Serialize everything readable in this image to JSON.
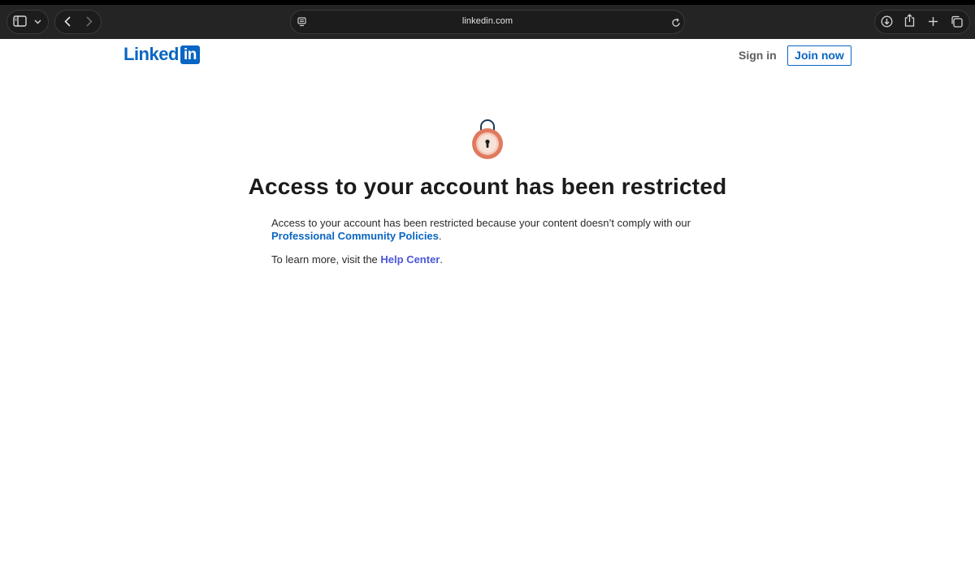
{
  "browser": {
    "url": "linkedin.com",
    "icons": [
      "sidebar-icon",
      "chevron-down-icon",
      "back-icon",
      "forward-icon",
      "page-menu-icon",
      "reload-icon",
      "download-icon",
      "share-icon",
      "new-tab-icon",
      "tabs-overview-icon"
    ]
  },
  "header": {
    "logo_text": "Linked",
    "logo_box_text": "in",
    "sign_in_label": "Sign in",
    "join_now_label": "Join now"
  },
  "main": {
    "icon": "lock-icon",
    "title": "Access to your account has been restricted",
    "paragraph1_text": "Access to your account has been restricted because your content doesn’t comply with our",
    "policies_link": "Professional Community Policies",
    "paragraph1_end": ".",
    "paragraph2_text": "To learn more, visit the",
    "help_link": "Help Center",
    "paragraph2_end": "."
  },
  "colors": {
    "brand": "#0a66c2",
    "lock_body": "#e07a5f",
    "lock_shackle": "#1b3a5c"
  }
}
